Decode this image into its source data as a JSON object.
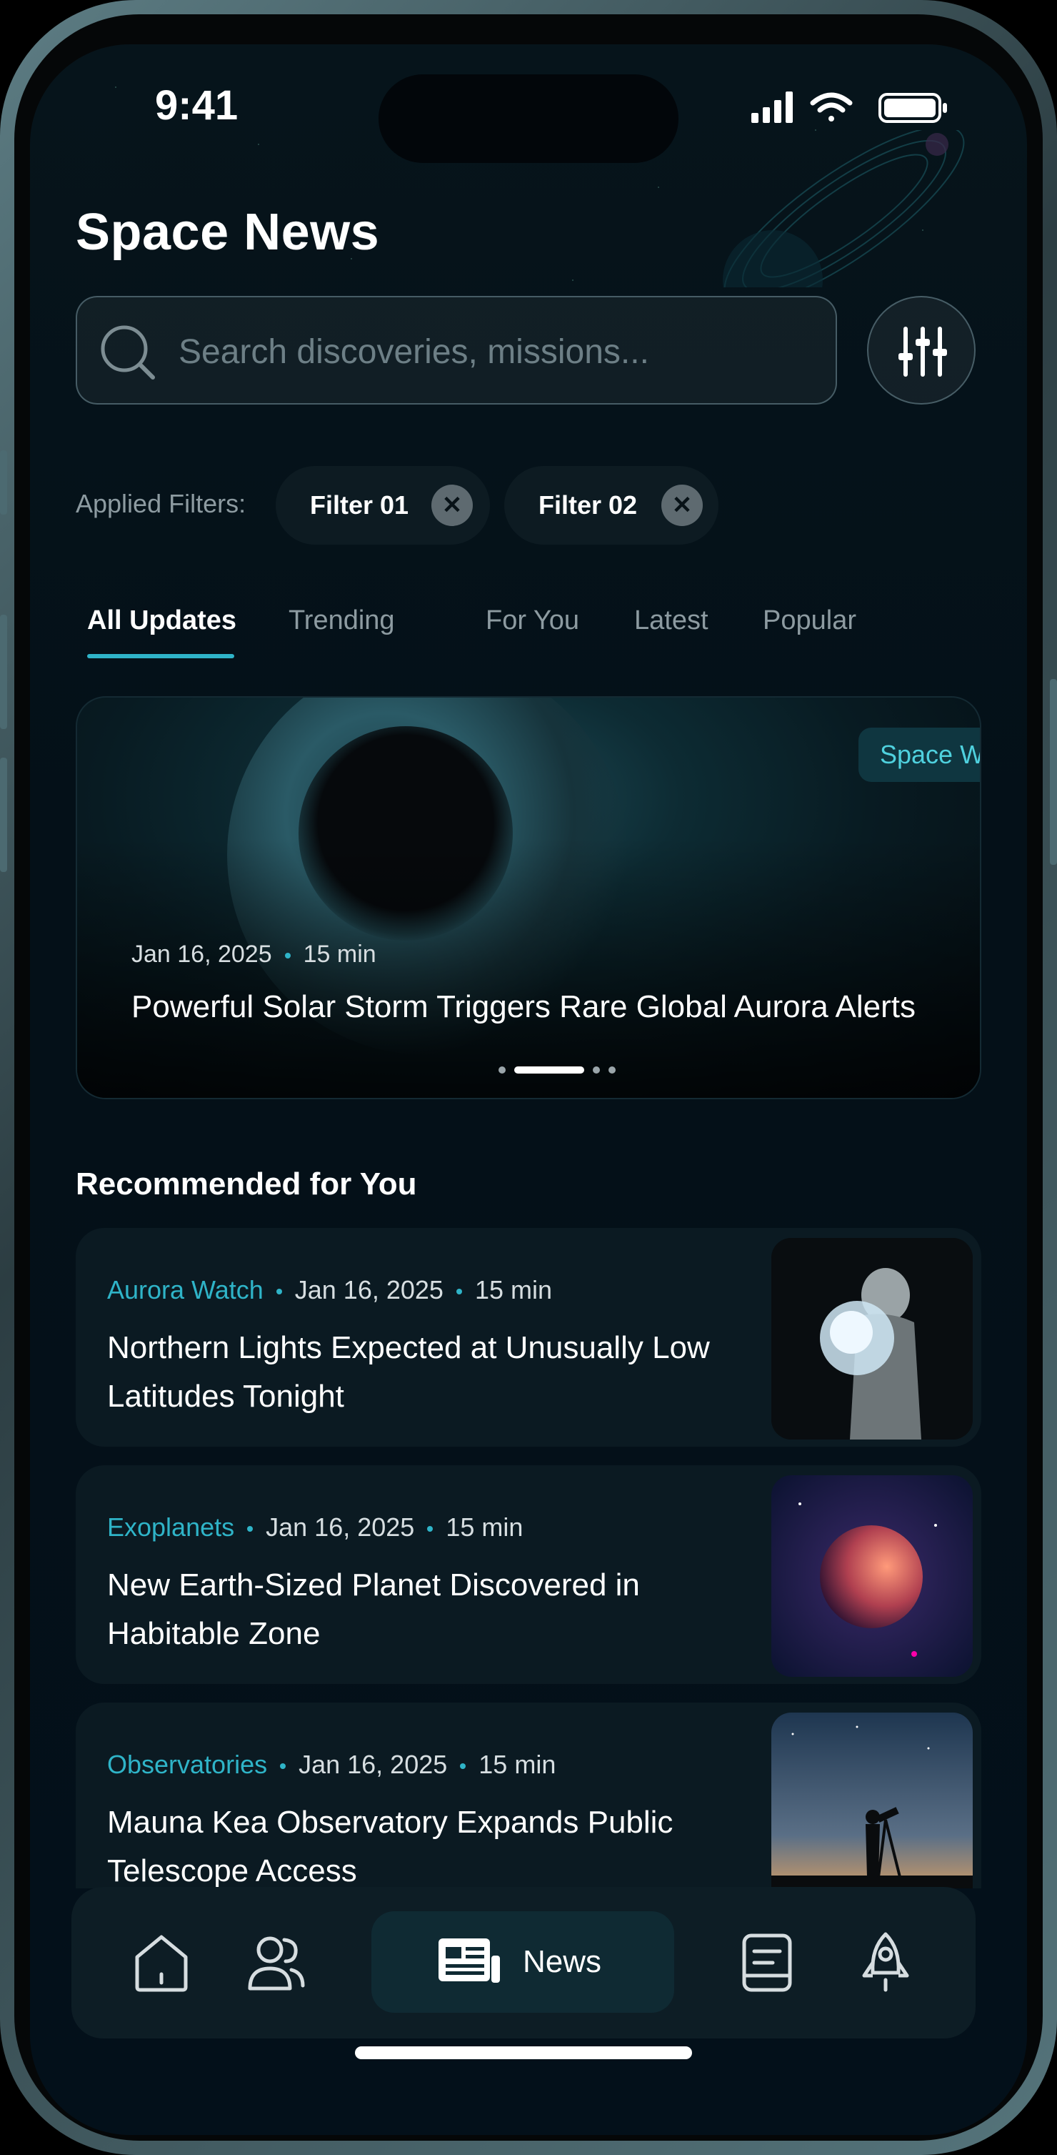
{
  "status_bar": {
    "time": "9:41"
  },
  "header": {
    "title": "Space News"
  },
  "search": {
    "placeholder": "Search discoveries, missions..."
  },
  "filters": {
    "label": "Applied Filters:",
    "chips": [
      {
        "label": "Filter 01"
      },
      {
        "label": "Filter 02"
      }
    ]
  },
  "tabs": [
    {
      "label": "All Updates",
      "active": true
    },
    {
      "label": "Trending"
    },
    {
      "label": "For You"
    },
    {
      "label": "Latest"
    },
    {
      "label": "Popular"
    }
  ],
  "hero": {
    "tag": "Space Weath",
    "date": "Jan 16, 2025",
    "read_time": "15 min",
    "title": "Powerful Solar Storm Triggers Rare Global Aurora Alerts",
    "pager_active_index": 1,
    "pager_count": 4
  },
  "recommended": {
    "title": "Recommended for You",
    "items": [
      {
        "category": "Aurora Watch",
        "date": "Jan 16, 2025",
        "read_time": "15 min",
        "title": "Northern Lights Expected at Unusually Low Latitudes Tonight"
      },
      {
        "category": "Exoplanets",
        "date": "Jan 16, 2025",
        "read_time": "15 min",
        "title": "New Earth-Sized Planet Discovered in Habitable Zone"
      },
      {
        "category": "Observatories",
        "date": "Jan 16, 2025",
        "read_time": "15 min",
        "title": "Mauna Kea Observatory Expands Public Telescope Access"
      }
    ]
  },
  "bottom_nav": {
    "items": [
      {
        "icon": "home-icon"
      },
      {
        "icon": "community-icon"
      },
      {
        "icon": "news-icon",
        "label": "News",
        "active": true
      },
      {
        "icon": "book-icon"
      },
      {
        "icon": "rocket-icon"
      }
    ]
  },
  "colors": {
    "accent": "#2fb4c8",
    "background": "#041018",
    "card": "#0b1a22"
  }
}
